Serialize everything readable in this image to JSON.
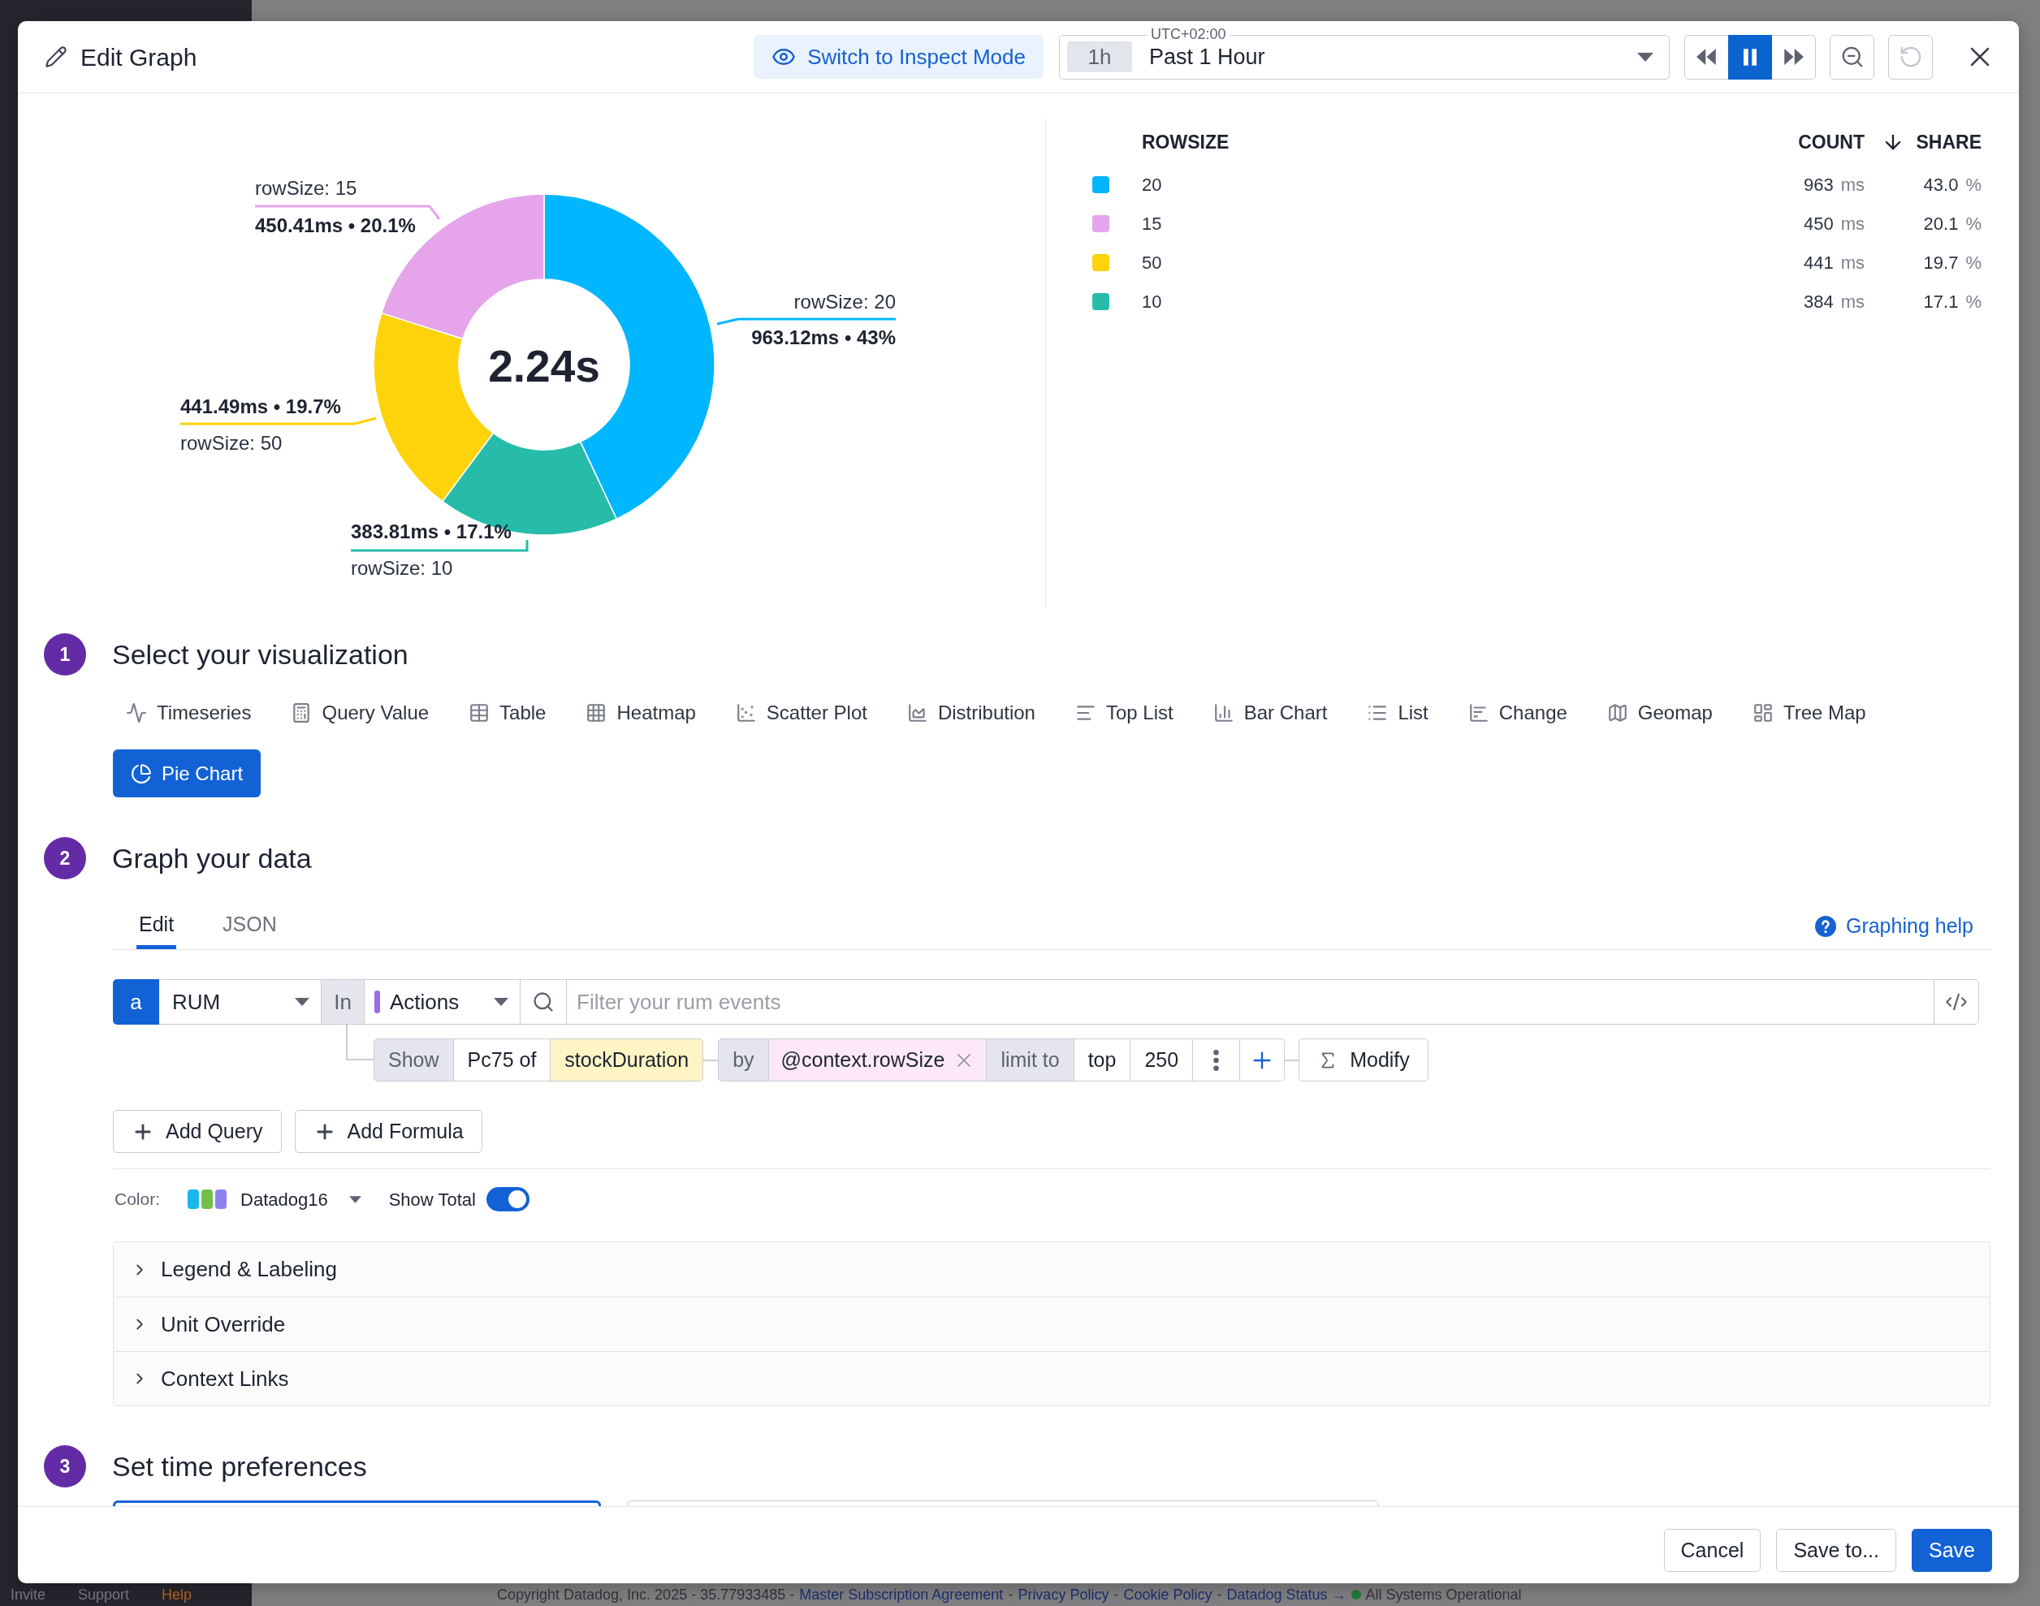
{
  "background_page": {
    "sidebar_links": [
      {
        "label": "Invite",
        "color": "#7b7b84"
      },
      {
        "label": "Support",
        "color": "#7b7b84"
      },
      {
        "label": "Help",
        "color": "#b8661c"
      }
    ],
    "footer": [
      {
        "kind": "text",
        "text": "Copyright Datadog, Inc. 2025 - 35.77933485 -"
      },
      {
        "kind": "link",
        "text": "Master Subscription Agreement"
      },
      {
        "kind": "text",
        "text": "-"
      },
      {
        "kind": "link",
        "text": "Privacy Policy"
      },
      {
        "kind": "text",
        "text": "-"
      },
      {
        "kind": "link",
        "text": "Cookie Policy"
      },
      {
        "kind": "text",
        "text": "-"
      },
      {
        "kind": "link",
        "text": "Datadog Status →"
      },
      {
        "kind": "status",
        "text": "All Systems Operational"
      }
    ]
  },
  "dialog": {
    "header": {
      "title": "Edit Graph",
      "inspect_button": "Switch to Inspect Mode",
      "time_picker": {
        "timezone": "UTC+02:00",
        "shortcut": "1h",
        "value": "Past 1 Hour"
      },
      "playback": [
        {
          "kind": "rewind",
          "selected": false
        },
        {
          "kind": "pause",
          "selected": true
        },
        {
          "kind": "forward",
          "selected": false
        }
      ],
      "tools": [
        {
          "kind": "zoom_out",
          "disabled": false
        },
        {
          "kind": "reset",
          "disabled": true
        },
        {
          "kind": "close",
          "disabled": false
        }
      ]
    },
    "chart": {
      "center_label": "2.24s",
      "chart_data": {
        "type": "donut",
        "categories": [
          "rowSize: 20",
          "rowSize: 10",
          "rowSize: 50",
          "rowSize: 15"
        ],
        "values": [
          963.12,
          383.81,
          441.49,
          450.41
        ],
        "colors": [
          "#00b6fe",
          "#27bcaa",
          "#fed30b",
          "#e6a4ea"
        ],
        "value_labels": [
          "963.12ms • 43%",
          "383.81ms • 17.1%",
          "441.49ms • 19.7%",
          "450.41ms • 20.1%"
        ]
      }
    },
    "legend": {
      "columns": [
        {
          "label": "ROWSIZE",
          "sorted": false
        },
        {
          "label": "COUNT",
          "sorted": false
        },
        {
          "label": "SHARE",
          "sorted": true
        }
      ],
      "rows": [
        {
          "label": "20",
          "color": "#00b6fe",
          "count": "963",
          "count_unit": "ms",
          "share": "43.0",
          "share_unit": "%"
        },
        {
          "label": "15",
          "color": "#e6a4ea",
          "count": "450",
          "count_unit": "ms",
          "share": "20.1",
          "share_unit": "%"
        },
        {
          "label": "50",
          "color": "#fed30b",
          "count": "441",
          "count_unit": "ms",
          "share": "19.7",
          "share_unit": "%"
        },
        {
          "label": "10",
          "color": "#27bcaa",
          "count": "384",
          "count_unit": "ms",
          "share": "17.1",
          "share_unit": "%"
        }
      ]
    },
    "visualization": {
      "number": "1",
      "title": "Select your visualization",
      "options": [
        {
          "kind": "timeseries",
          "label": "Timeseries",
          "selected": false
        },
        {
          "kind": "query_value",
          "label": "Query Value",
          "selected": false
        },
        {
          "kind": "table",
          "label": "Table",
          "selected": false
        },
        {
          "kind": "heatmap",
          "label": "Heatmap",
          "selected": false
        },
        {
          "kind": "scatter_plot",
          "label": "Scatter Plot",
          "selected": false
        },
        {
          "kind": "distribution",
          "label": "Distribution",
          "selected": false
        },
        {
          "kind": "top_list",
          "label": "Top List",
          "selected": false
        },
        {
          "kind": "bar_chart",
          "label": "Bar Chart",
          "selected": false
        },
        {
          "kind": "list",
          "label": "List",
          "selected": false
        },
        {
          "kind": "change",
          "label": "Change",
          "selected": false
        },
        {
          "kind": "geomap",
          "label": "Geomap",
          "selected": false
        },
        {
          "kind": "tree_map",
          "label": "Tree Map",
          "selected": false
        },
        {
          "kind": "pie_chart",
          "label": "Pie Chart",
          "selected": true
        }
      ]
    },
    "data": {
      "number": "2",
      "title": "Graph your data",
      "tabs": [
        {
          "label": "Edit",
          "selected": true
        },
        {
          "label": "JSON",
          "selected": false
        }
      ],
      "help_link": "Graphing help",
      "query": {
        "letter": "a",
        "source": "RUM",
        "in_label": "In",
        "event_type": "Actions",
        "search_placeholder": "Filter your rum events",
        "clause_groups": [
          [
            {
              "kind": "label",
              "text": "Show"
            },
            {
              "kind": "value",
              "text": "Pc75 of"
            },
            {
              "kind": "measure",
              "text": "stockDuration"
            }
          ],
          [
            {
              "kind": "label",
              "text": "by"
            },
            {
              "kind": "tag",
              "text": "@context.rowSize"
            },
            {
              "kind": "label",
              "text": "limit to"
            },
            {
              "kind": "value",
              "text": "top"
            },
            {
              "kind": "value",
              "text": "250"
            },
            {
              "kind": "menu"
            },
            {
              "kind": "add"
            }
          ]
        ],
        "modify": "Modify"
      },
      "actions": [
        "Add Query",
        "Add Formula"
      ],
      "color_label": "Color:",
      "palette": "Datadog16",
      "show_total": {
        "label": "Show Total",
        "on": true
      },
      "sections": [
        {
          "label": "Legend & Labeling",
          "expanded": false
        },
        {
          "label": "Unit Override",
          "expanded": false
        },
        {
          "label": "Context Links",
          "expanded": false
        }
      ]
    },
    "time": {
      "number": "3",
      "title": "Set time preferences",
      "options": [
        {
          "selected": true
        },
        {
          "selected": false
        }
      ]
    },
    "buttons": [
      {
        "label": "Cancel",
        "kind": "secondary"
      },
      {
        "label": "Save to...",
        "kind": "secondary"
      },
      {
        "label": "Save",
        "kind": "primary"
      }
    ]
  }
}
